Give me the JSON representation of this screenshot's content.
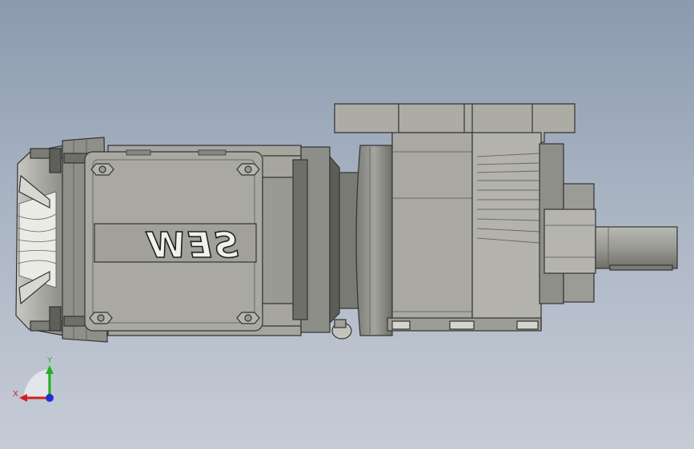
{
  "scene": {
    "model": {
      "brand_logo": "SEW"
    },
    "triad": {
      "x_label": "X",
      "y_label": "Y",
      "x_color": "#d42020",
      "y_color": "#22b022",
      "z_color": "#2030d8"
    }
  },
  "colors": {
    "background_top": "#8b9aae",
    "background_bottom": "#c6ccd6",
    "body_gray": "#a6a69f",
    "dark_edge": "#3c3c3c"
  }
}
